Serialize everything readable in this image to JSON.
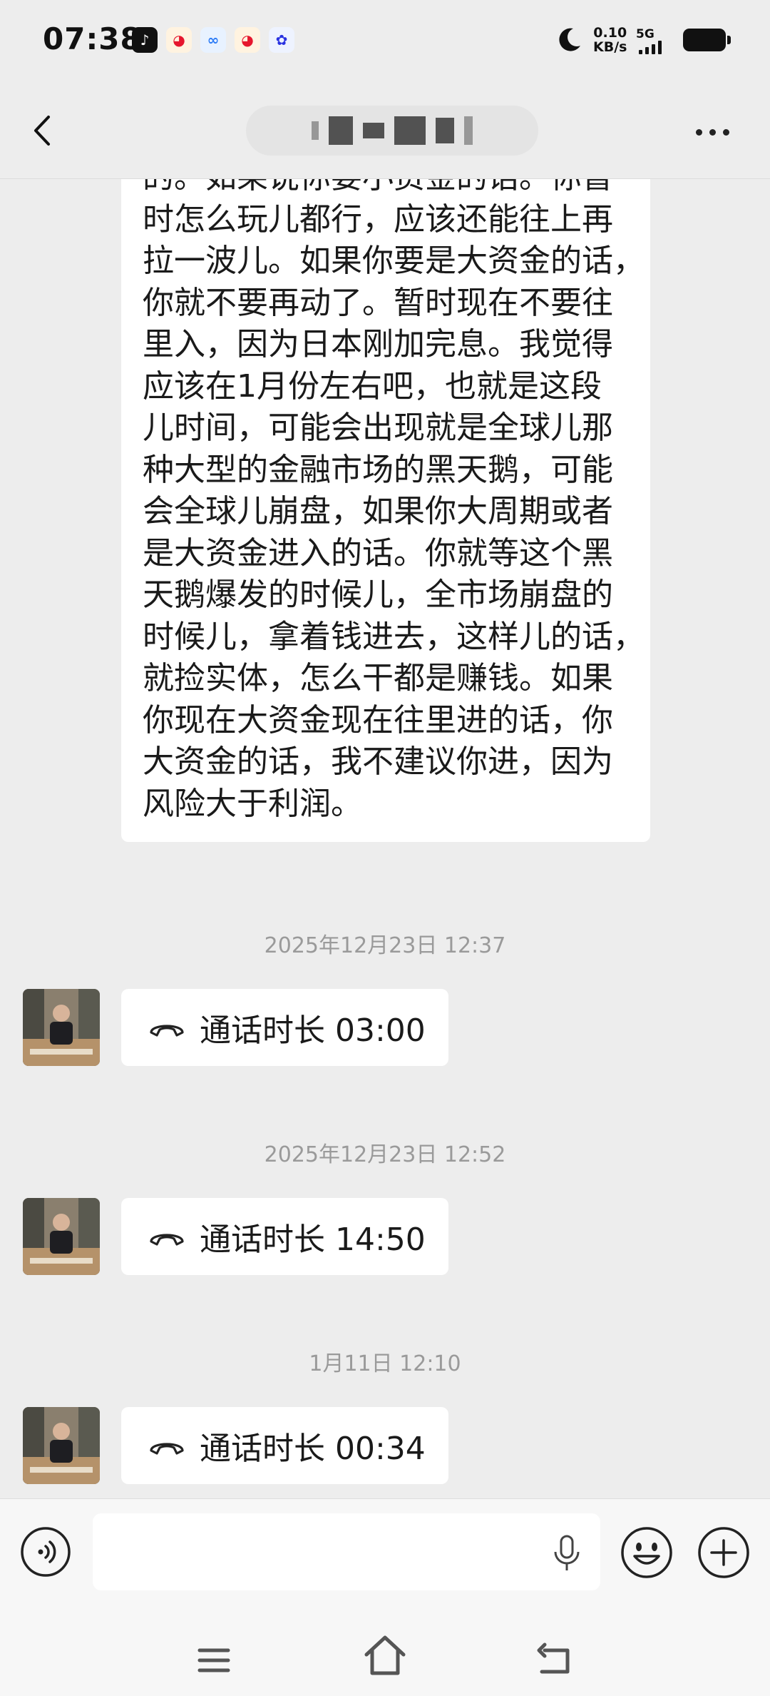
{
  "status_bar": {
    "time": "07:38",
    "app_icons": [
      {
        "icon": "tiktok-icon",
        "glyph": "♪"
      },
      {
        "icon": "weibo-icon",
        "glyph": "◕"
      },
      {
        "icon": "cloud-icon",
        "glyph": "∞"
      },
      {
        "icon": "weibo-icon",
        "glyph": "◕"
      },
      {
        "icon": "baidu-icon",
        "glyph": "✿"
      }
    ],
    "speed_value": "0.10",
    "speed_unit": "KB/s",
    "network": "5G"
  },
  "chat": {
    "title_masked": true,
    "messages_text": [
      "的。如果说你要小资金的话。你暂",
      "时怎么玩儿都行，应该还能往上再",
      "拉一波儿。如果你要是大资金的话，",
      "你就不要再动了。暂时现在不要往",
      "里入，因为日本刚加完息。我觉得",
      "应该在1月份左右吧，也就是这段",
      "儿时间，可能会出现就是全球儿那",
      "种大型的金融市场的黑天鹅，可能",
      "会全球儿崩盘，如果你大周期或者",
      "是大资金进入的话。你就等这个黑",
      "天鹅爆发的时候儿，全市场崩盘的",
      "时候儿，拿着钱进去，这样儿的话，",
      "就捡实体，怎么干都是赚钱。如果",
      "你现在大资金现在往里进的话，你",
      "大资金的话，我不建议你进，因为",
      "风险大于利润。"
    ],
    "calls": [
      {
        "timestamp": "2025年12月23日 12:37",
        "label": "通话时长 03:00"
      },
      {
        "timestamp": "2025年12月23日 12:52",
        "label": "通话时长 14:50"
      },
      {
        "timestamp": "1月11日 12:10",
        "label": "通话时长 00:34"
      }
    ]
  },
  "input_bar": {
    "value": "",
    "placeholder": ""
  },
  "colors": {
    "background": "#ededed",
    "bubble": "#ffffff",
    "timestamp": "#9a9a9a"
  }
}
